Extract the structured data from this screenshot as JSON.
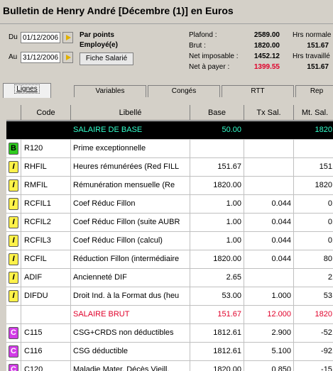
{
  "window": {
    "title": "Bulletin de Henry André [Décembre (1)] en Euros"
  },
  "period": {
    "du_label": "Du",
    "du_value": "01/12/2006",
    "au_label": "Au",
    "au_value": "31/12/2006"
  },
  "employee": {
    "mode": "Par points",
    "type": "Employé(e)",
    "fiche_button": "Fiche Salarié"
  },
  "totals": {
    "plafond_label": "Plafond :",
    "plafond_value": "2589.00",
    "brut_label": "Brut :",
    "brut_value": "1820.00",
    "net_imposable_label": "Net imposable :",
    "net_imposable_value": "1452.12",
    "net_payer_label": "Net à payer :",
    "net_payer_value": "1399.55",
    "hrs_normales_label": "Hrs normale",
    "hrs_normales_value": "151.67",
    "hrs_travaillees_label": "Hrs travaillé",
    "hrs_travaillees_value": "151.67"
  },
  "tabs": [
    "Lignes",
    "Variables",
    "Congés",
    "RTT",
    "Rep"
  ],
  "columns": [
    "Code",
    "Libellé",
    "Base",
    "Tx Sal.",
    "Mt. Sal."
  ],
  "rows": [
    {
      "icon": "",
      "code": "",
      "libelle": "SALAIRE DE BASE",
      "base": "50.00",
      "tx": "",
      "mt": "1820."
    },
    {
      "icon": "B",
      "code": "R120",
      "libelle": "Prime exceptionnelle",
      "base": "",
      "tx": "",
      "mt": ""
    },
    {
      "icon": "I",
      "code": "RHFIL",
      "libelle": "Heures rémunérées (Red FILL",
      "base": "151.67",
      "tx": "",
      "mt": "151."
    },
    {
      "icon": "I",
      "code": "RMFIL",
      "libelle": "Rémunération mensuelle (Re",
      "base": "1820.00",
      "tx": "",
      "mt": "1820."
    },
    {
      "icon": "I",
      "code": "RCFIL1",
      "libelle": "Coef Réduc Fillon",
      "base": "1.00",
      "tx": "0.044",
      "mt": "0."
    },
    {
      "icon": "I",
      "code": "RCFIL2",
      "libelle": "Coef Réduc Fillon (suite AUBR",
      "base": "1.00",
      "tx": "0.044",
      "mt": "0."
    },
    {
      "icon": "I",
      "code": "RCFIL3",
      "libelle": "Coef Réduc Fillon (calcul)",
      "base": "1.00",
      "tx": "0.044",
      "mt": "0."
    },
    {
      "icon": "I",
      "code": "RCFIL",
      "libelle": "Réduction Fillon (intermédiaire",
      "base": "1820.00",
      "tx": "0.044",
      "mt": "80."
    },
    {
      "icon": "I",
      "code": "ADIF",
      "libelle": "Ancienneté DIF",
      "base": "2.65",
      "tx": "",
      "mt": "2."
    },
    {
      "icon": "I",
      "code": "DIFDU",
      "libelle": "Droit Ind. à la Format dus (heu",
      "base": "53.00",
      "tx": "1.000",
      "mt": "53."
    },
    {
      "icon": "",
      "code": "",
      "libelle": "SALAIRE BRUT",
      "base": "151.67",
      "tx": "12.000",
      "mt": "1820."
    },
    {
      "icon": "C",
      "code": "C115",
      "libelle": "CSG+CRDS non déductibles",
      "base": "1812.61",
      "tx": "2.900",
      "mt": "-52."
    },
    {
      "icon": "C",
      "code": "C116",
      "libelle": "CSG déductible",
      "base": "1812.61",
      "tx": "5.100",
      "mt": "-92."
    },
    {
      "icon": "C",
      "code": "C120",
      "libelle": "Maladie Mater. Décès Vieill.",
      "base": "1820.00",
      "tx": "0.850",
      "mt": "-15."
    }
  ],
  "colors": {
    "header_bg": "#d4d0c8",
    "net_red": "#e0002a",
    "base_row_text": "#33ffcc"
  }
}
